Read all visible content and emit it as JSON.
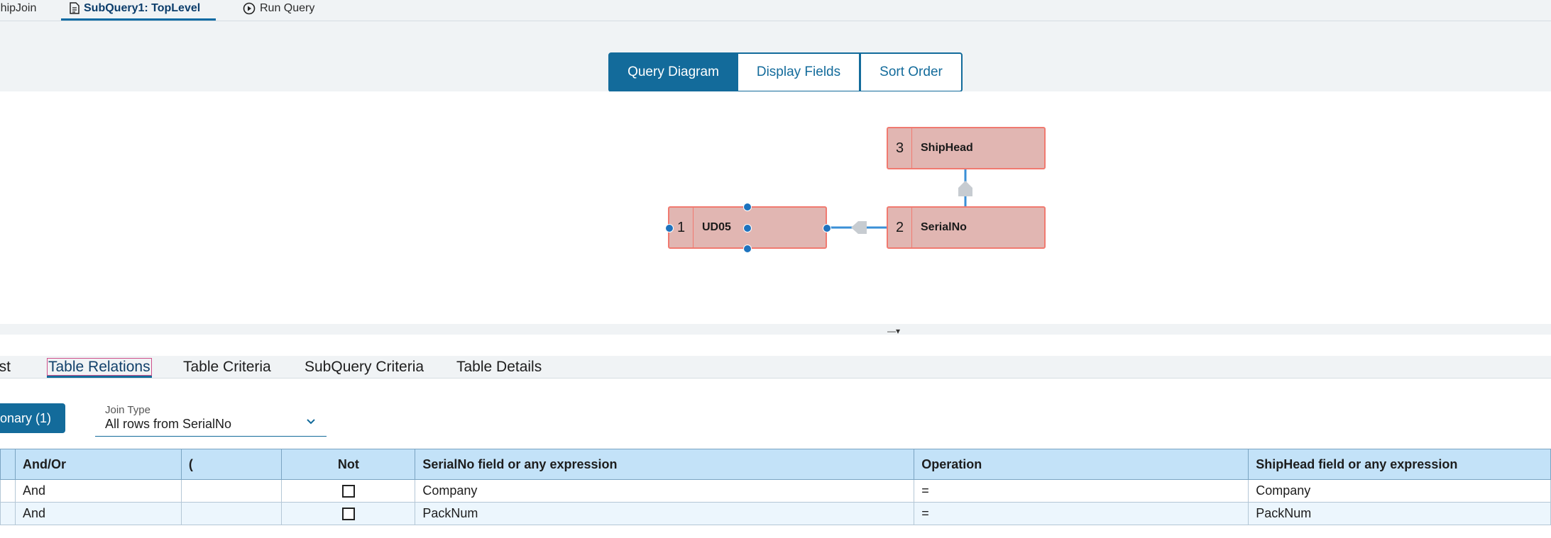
{
  "top_tabs": [
    {
      "label": "ShipJoin"
    },
    {
      "label": "SubQuery1: TopLevel"
    },
    {
      "label": "Run Query"
    }
  ],
  "view_switch": {
    "query_diagram": "Query Diagram",
    "display_fields": "Display Fields",
    "sort_order": "Sort Order"
  },
  "diagram": {
    "nodes": [
      {
        "num": "1",
        "name": "UD05"
      },
      {
        "num": "2",
        "name": "SerialNo"
      },
      {
        "num": "3",
        "name": "ShipHead"
      }
    ],
    "splitter_glyph": "—▾"
  },
  "bottom_tabs": [
    {
      "label": "ist"
    },
    {
      "label": "Table Relations"
    },
    {
      "label": "Table Criteria"
    },
    {
      "label": "SubQuery Criteria"
    },
    {
      "label": "Table Details"
    }
  ],
  "relations": {
    "button_label": "onary (1)",
    "join_type_label": "Join Type",
    "join_type_value": "All rows from SerialNo"
  },
  "grid": {
    "columns": [
      "And/Or",
      "(",
      "Not",
      "SerialNo field or any expression",
      "Operation",
      "ShipHead field or any expression"
    ],
    "rows": [
      {
        "andor": "And",
        "paren": "",
        "not": false,
        "left": "Company",
        "op": "=",
        "right": "Company"
      },
      {
        "andor": "And",
        "paren": "",
        "not": false,
        "left": "PackNum",
        "op": "=",
        "right": "PackNum"
      }
    ]
  },
  "colors": {
    "accent": "#136b9b",
    "node_fill": "#e1b6b2",
    "node_border": "#f07a70",
    "grid_header": "#c3e2f8"
  }
}
